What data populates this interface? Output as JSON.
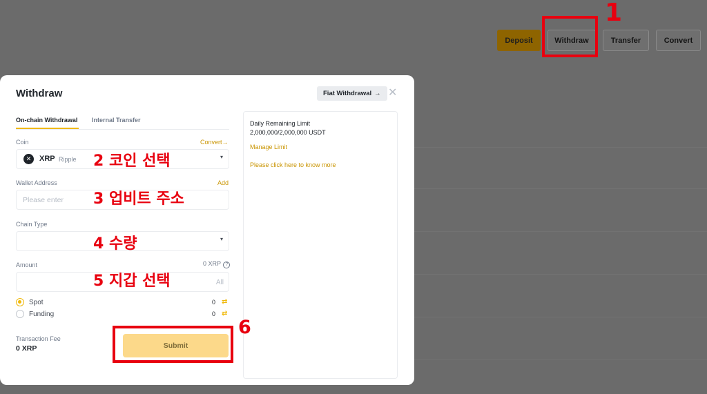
{
  "top_actions": {
    "deposit": "Deposit",
    "withdraw": "Withdraw",
    "transfer": "Transfer",
    "convert": "Convert"
  },
  "modal": {
    "title": "Withdraw",
    "fiat_button": "Fiat Withdrawal",
    "fiat_arrow": "→",
    "close_glyph": "✕",
    "tabs": {
      "onchain": "On-chain Withdrawal",
      "internal": "Internal Transfer"
    },
    "coin": {
      "label": "Coin",
      "convert_link": "Convert",
      "convert_arrow": "→",
      "symbol": "XRP",
      "name": "Ripple",
      "logo_glyph": "✕"
    },
    "wallet": {
      "label": "Wallet Address",
      "add_link": "Add",
      "placeholder": "Please enter"
    },
    "chain": {
      "label": "Chain Type"
    },
    "amount": {
      "label": "Amount",
      "balance": "0 XRP",
      "help_glyph": "?",
      "all_button": "All"
    },
    "wallets": [
      {
        "label": "Spot",
        "value": "0",
        "selected": true
      },
      {
        "label": "Funding",
        "value": "0",
        "selected": false
      }
    ],
    "fee": {
      "label": "Transaction Fee",
      "value": "0 XRP"
    },
    "submit": "Submit",
    "caret_glyph": "▾",
    "swap_glyph": "⇄"
  },
  "side_panel": {
    "limit_label": "Daily Remaining Limit",
    "limit_value": "2,000,000/2,000,000 USDT",
    "manage_link": "Manage Limit",
    "info_link": "Please click here to know more"
  },
  "annotations": {
    "step1": "1",
    "step2": "2 코인 선택",
    "step3": "3 업비트 주소",
    "step4": "4 수량",
    "step5": "5 지갑 선택",
    "step6": "6"
  },
  "colors": {
    "accent": "#f0b90b",
    "link": "#c99400",
    "annotation": "#e8000f",
    "overlay": "#6b6b6b"
  }
}
